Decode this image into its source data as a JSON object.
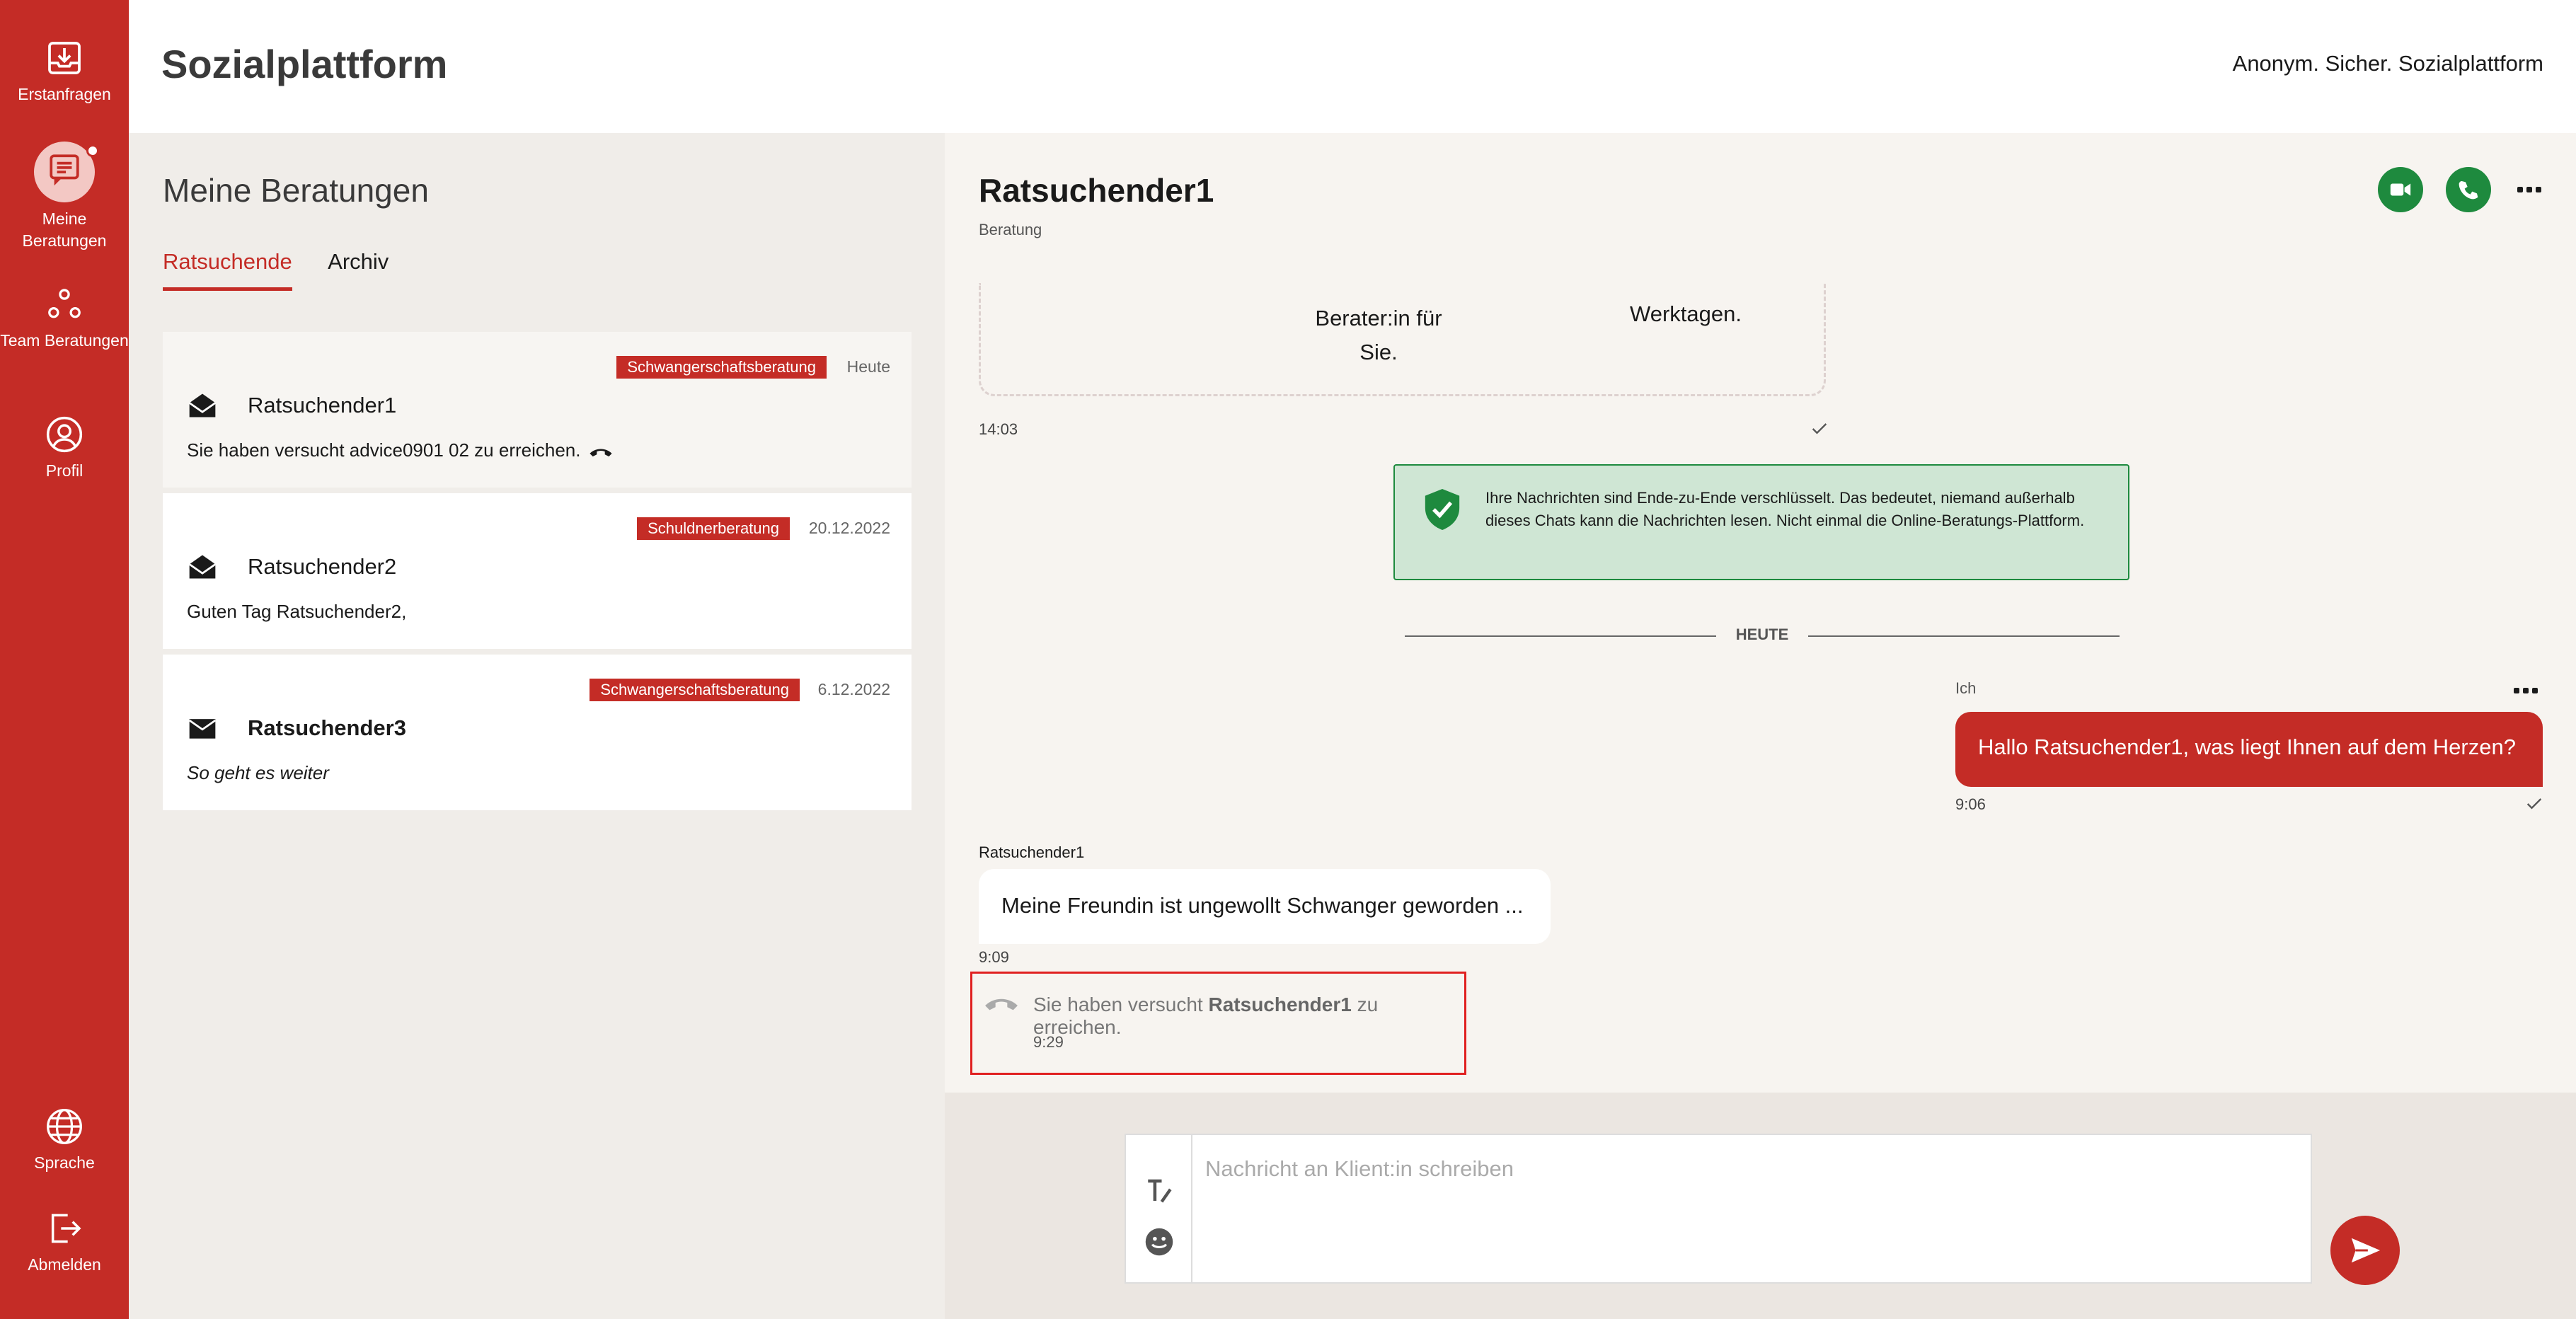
{
  "app": {
    "brand": "Sozialplattform",
    "tagline": "Anonym. Sicher. Sozialplattform"
  },
  "nav": {
    "erstanfragen": "Erstanfragen",
    "meine_beratungen": "Meine Beratungen",
    "team_beratungen": "Team Beratungen",
    "profil": "Profil",
    "sprache": "Sprache",
    "abmelden": "Abmelden"
  },
  "list": {
    "title": "Meine Beratungen",
    "tabs": [
      "Ratsuchende",
      "Archiv"
    ],
    "cards": [
      {
        "badge": "Schwangerschaftsberatung",
        "date": "Heute",
        "name": "Ratsuchender1",
        "preview": "Sie haben versucht advice0901 02 zu erreichen.",
        "icon": "envelope-open-icon"
      },
      {
        "badge": "Schuldnerberatung",
        "date": "20.12.2022",
        "name": "Ratsuchender2",
        "preview": "Guten Tag Ratsuchender2,",
        "icon": "envelope-open-icon"
      },
      {
        "badge": "Schwangerschaftsberatung",
        "date": "6.12.2022",
        "name": "Ratsuchender3",
        "preview": "So geht es weiter",
        "icon": "envelope-closed-icon"
      }
    ]
  },
  "chat": {
    "name": "Ratsuchender1",
    "subtitle": "Beratung",
    "info_left": "Berater:in für Sie.",
    "info_right": "Werktagen.",
    "info_time": "14:03",
    "e2e_text": "Ihre Nachrichten sind Ende-zu-Ende verschlüsselt. Das bedeutet, niemand außerhalb dieses Chats kann die Nachrichten lesen. Nicht einmal die Online-Beratungs-Plattform.",
    "divider": "HEUTE",
    "my_sender": "Ich",
    "my_message": "Hallo Ratsuchender1, was liegt Ihnen auf dem Herzen?",
    "my_time": "9:06",
    "their_sender": "Ratsuchender1",
    "their_message": "Meine Freundin ist ungewollt Schwanger geworden ...",
    "their_time": "9:09",
    "call_prefix": "Sie haben versucht",
    "call_name": "Ratsuchender1",
    "call_suffix": "zu erreichen.",
    "call_time": "9:29"
  },
  "composer": {
    "placeholder": "Nachricht an Klient:in schreiben"
  },
  "colors": {
    "primary": "#c42c26",
    "success": "#1e8a3e",
    "e2e_bg": "#cfe6d4"
  }
}
